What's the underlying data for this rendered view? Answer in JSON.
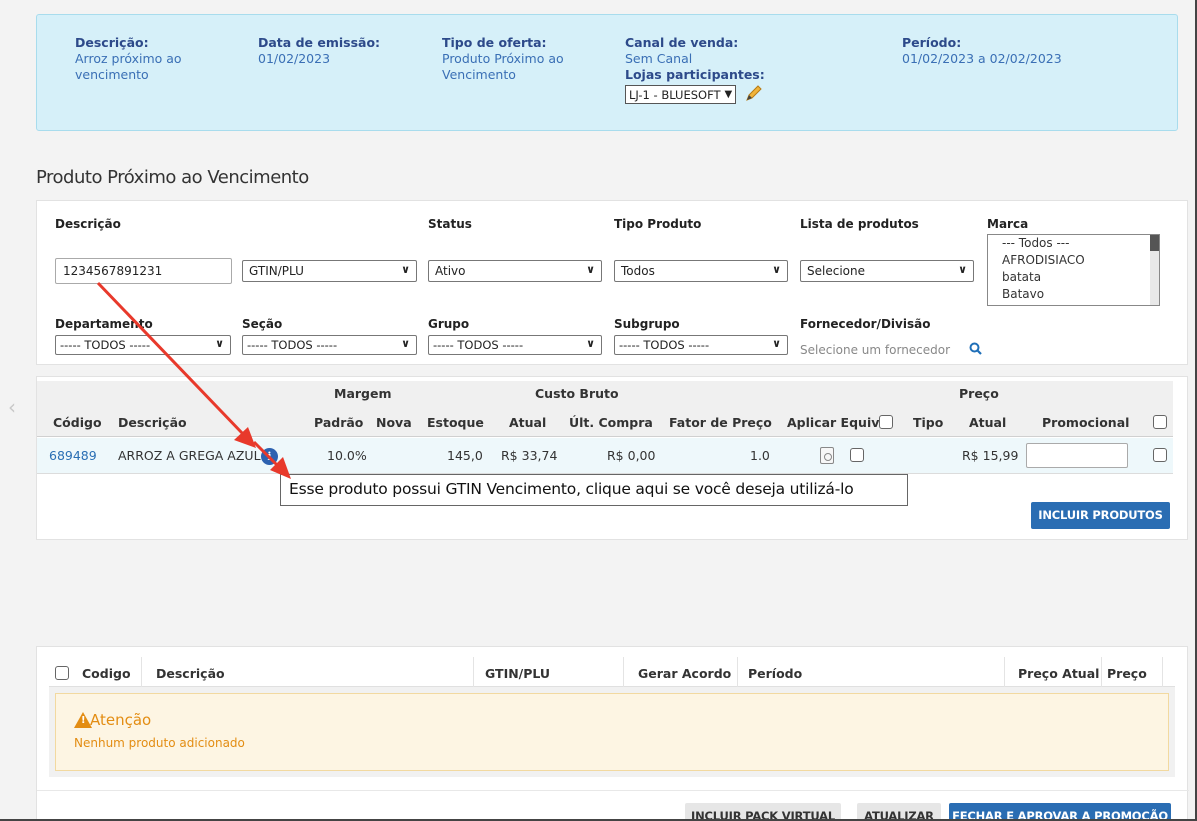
{
  "info": {
    "descricao_label": "Descrição:",
    "descricao_value_1": "Arroz próximo ao",
    "descricao_value_2": "vencimento",
    "data_label": "Data de emissão:",
    "data_value": "01/02/2023",
    "tipo_label": "Tipo de oferta:",
    "tipo_value_1": "Produto Próximo ao",
    "tipo_value_2": "Vencimento",
    "canal_label": "Canal de venda:",
    "canal_value": "Sem Canal",
    "lojas_label": "Lojas participantes:",
    "lojas_value": "LJ-1 - BLUESOFT",
    "periodo_label": "Período:",
    "periodo_value": "01/02/2023 a 02/02/2023"
  },
  "section_title": "Produto Próximo ao Vencimento",
  "filters": {
    "descricao_label": "Descrição",
    "descricao_value": "1234567891231",
    "tipo_busca": "GTIN/PLU",
    "status_label": "Status",
    "status_value": "Ativo",
    "tipo_produto_label": "Tipo Produto",
    "tipo_produto_value": "Todos",
    "lista_label": "Lista de produtos",
    "lista_value": "Selecione",
    "marca_label": "Marca",
    "marca_options": [
      "--- Todos ---",
      "AFRODISIACO",
      "batata",
      "Batavo"
    ],
    "departamento_label": "Departamento",
    "departamento_value": "----- TODOS -----",
    "secao_label": "Seção",
    "secao_value": "----- TODOS -----",
    "grupo_label": "Grupo",
    "grupo_value": "----- TODOS -----",
    "subgrupo_label": "Subgrupo",
    "subgrupo_value": "----- TODOS -----",
    "fornecedor_label": "Fornecedor/Divisão",
    "fornecedor_placeholder": "Selecione um fornecedor"
  },
  "grid": {
    "group_margem": "Margem",
    "group_custo": "Custo Bruto",
    "group_preco": "Preço",
    "h_codigo": "Código",
    "h_descricao": "Descrição",
    "h_padrao": "Padrão",
    "h_nova": "Nova",
    "h_estoque": "Estoque",
    "h_atual": "Atual",
    "h_ult": "Últ. Compra",
    "h_fator": "Fator de Preço",
    "h_aplicar": "Aplicar Equiv.",
    "h_tipo": "Tipo",
    "h_preco_atual": "Atual",
    "h_promocional": "Promocional",
    "row": {
      "codigo": "689489",
      "descricao": "ARROZ A GREGA AZUL",
      "padrao": "10.0%",
      "estoque": "145,0",
      "atual": "R$ 33,74",
      "ult": "R$ 0,00",
      "fator": "1.0",
      "preco_atual": "R$ 15,99"
    },
    "btn_incluir": "INCLUIR PRODUTOS"
  },
  "tooltip": "Esse produto possui GTIN Vencimento, clique aqui se você deseja utilizá-lo",
  "bottom": {
    "h_codigo": "Codigo",
    "h_descricao": "Descrição",
    "h_gtin": "GTIN/PLU",
    "h_gerar": "Gerar Acordo",
    "h_periodo": "Período",
    "h_preco_atual": "Preço Atual",
    "h_preco": "Preço",
    "alert_title": "Atenção",
    "alert_msg": "Nenhum produto adicionado",
    "btn_pack": "INCLUIR PACK VIRTUAL",
    "btn_atualizar": "ATUALIZAR",
    "btn_fechar": "FECHAR E APROVAR A PROMOÇÃO"
  },
  "colors": {
    "accent": "#2a6db3",
    "info_bg": "#d6f0f9",
    "warning": "#e38d13",
    "annotation_arrow": "#e8392b"
  }
}
